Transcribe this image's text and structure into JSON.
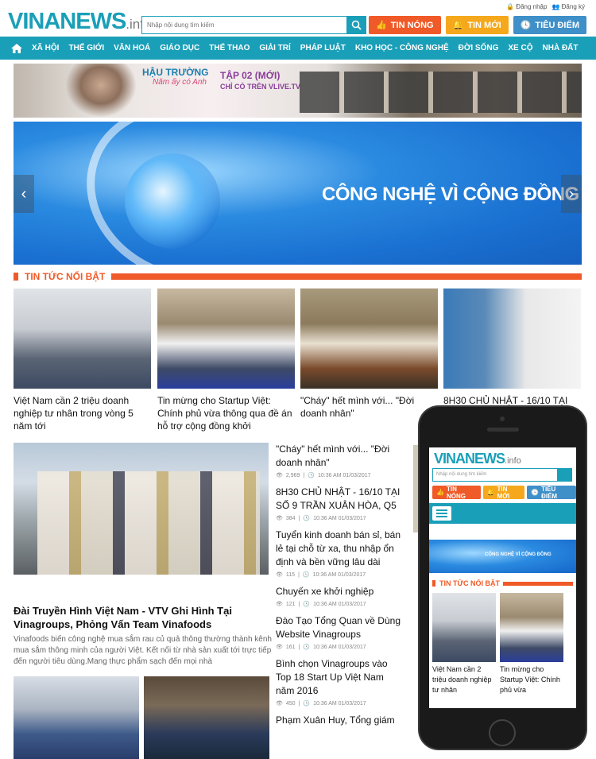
{
  "header": {
    "logo_main": "VINANEWS",
    "logo_suffix": ".info",
    "search_placeholder": "Nhập nội dung tìm kiếm",
    "login": "Đăng nhập",
    "register": "Đăng ký",
    "pills": [
      {
        "label": "TIN NÓNG",
        "color": "#f05a28",
        "icon": "thumbs-up-icon"
      },
      {
        "label": "TIN MỚI",
        "color": "#f5a81c",
        "icon": "bell-icon"
      },
      {
        "label": "TIÊU ĐIỂM",
        "color": "#3f8fc9",
        "icon": "clock-icon"
      }
    ]
  },
  "nav": {
    "items": [
      "XÃ HỘI",
      "THẾ GIỚI",
      "VĂN HOÁ",
      "GIÁO DỤC",
      "THỂ THAO",
      "GIẢI TRÍ",
      "PHÁP LUẬT",
      "KHO HỌC - CÔNG NGHỆ",
      "ĐỜI SỐNG",
      "XE CỘ",
      "NHÀ ĐẤT"
    ]
  },
  "ad": {
    "line1": "HẬU TRƯỜNG",
    "line2": "Năm ấy có Anh",
    "line3": "TẬP 02 (MỚI)",
    "line4": "CHỈ CÓ TRÊN VLIVE.TV"
  },
  "banner": {
    "text": "CÔNG NGHỆ VÌ CỘNG ĐỒNG"
  },
  "featured": {
    "title": "TIN TỨC NỔI BẬT",
    "items": [
      {
        "caption": "Việt Nam cần 2 triệu doanh nghiệp tư nhân trong vòng 5 năm tới"
      },
      {
        "caption": "Tin mừng cho Startup Việt: Chính phủ vừa thông qua đề án hỗ trợ cộng đồng khởi"
      },
      {
        "caption": "\"Cháy\" hết mình với... \"Đời doanh nhân\""
      },
      {
        "caption": "8H30 CHỦ NHẬT - 16/10 TẠI"
      }
    ]
  },
  "main_story": {
    "title": "Đài Truyền Hình Việt Nam - VTV Ghi Hình Tại Vinagroups, Phỏng Vấn Team Vinafoods",
    "desc": "Vinafoods biến công nghệ mua sắm rau củ quả thông thường thành kênh mua sắm thông minh của người Việt. Kết nối từ nhà sản xuất tới trực tiếp đến người tiêu dùng.Mang thực phẩm sạch đến mọi nhà"
  },
  "side_list": [
    {
      "title": "\"Cháy\" hết mình với... \"Đời doanh nhân\"",
      "views": "2,969",
      "time": "10:36 AM 01/03/2017"
    },
    {
      "title": "8H30 CHỦ NHẬT - 16/10 TẠI SỐ 9 TRẦN XUÂN HÒA, Q5",
      "views": "384",
      "time": "10:36 AM 01/03/2017"
    },
    {
      "title": "Tuyển kinh doanh bán sỉ, bán lẻ tại chỗ từ xa, thu nhập ổn định và bền vững lâu dài",
      "views": "115",
      "time": "10:36 AM 01/03/2017"
    },
    {
      "title": "Chuyến xe khởi nghiệp",
      "views": "121",
      "time": "10:36 AM 01/03/2017"
    },
    {
      "title": "Đào Tạo Tổng Quan về Dùng Website Vinagroups",
      "views": "161",
      "time": "10:36 AM 01/03/2017"
    },
    {
      "title": "Bình chọn Vinagroups vào Top 18 Start Up Việt Nam năm 2016",
      "views": "450",
      "time": "10:36 AM 01/03/2017"
    },
    {
      "title": "Phạm Xuân Huy, Tổng giám",
      "views": "",
      "time": ""
    }
  ],
  "mobile": {
    "logo_main": "VINANEWS",
    "logo_suffix": ".info",
    "search_placeholder": "Nhập nội dung tìm kiếm",
    "pills": [
      "TIN NÓNG",
      "TIN MỚI",
      "TIÊU ĐIỂM"
    ],
    "banner_text": "CÔNG NGHỆ VÌ CỘNG ĐỒNG",
    "section_title": "TIN TỨC NỔI BẬT",
    "items": [
      {
        "caption": "Việt Nam cần 2 triệu doanh nghiệp tư nhân"
      },
      {
        "caption": "Tin mừng cho Startup Việt: Chính phủ vừa"
      }
    ]
  }
}
